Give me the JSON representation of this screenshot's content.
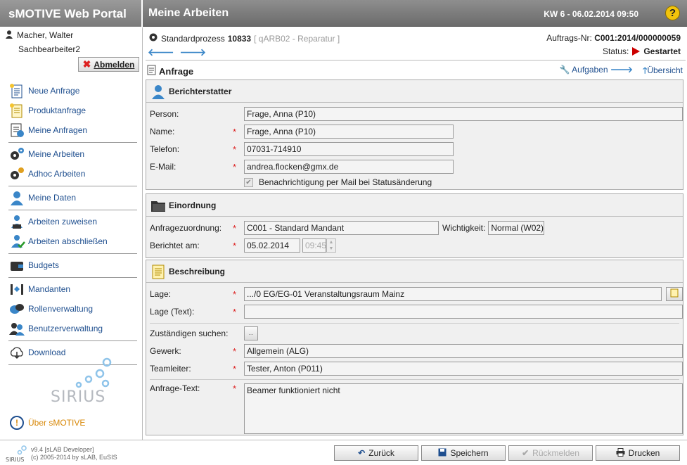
{
  "app": {
    "title": "sMOTIVE Web Portal",
    "page_title": "Meine Arbeiten",
    "week_date": "KW 6 - 06.02.2014 09:50",
    "help": "?"
  },
  "user": {
    "name": "Macher, Walter",
    "role": "Sachbearbeiter2",
    "logout": "Abmelden"
  },
  "sidebar": {
    "groups": [
      [
        {
          "label": "Neue Anfrage",
          "icon": "new-request-icon"
        },
        {
          "label": "Produktanfrage",
          "icon": "product-request-icon"
        },
        {
          "label": "Meine Anfragen",
          "icon": "my-requests-icon"
        }
      ],
      [
        {
          "label": "Meine Arbeiten",
          "icon": "gears-icon"
        },
        {
          "label": "Adhoc Arbeiten",
          "icon": "adhoc-gear-icon"
        }
      ],
      [
        {
          "label": "Meine Daten",
          "icon": "user-data-icon"
        }
      ],
      [
        {
          "label": "Arbeiten zuweisen",
          "icon": "assign-work-icon"
        },
        {
          "label": "Arbeiten abschließen",
          "icon": "complete-work-icon"
        }
      ],
      [
        {
          "label": "Budgets",
          "icon": "wallet-icon"
        }
      ],
      [
        {
          "label": "Mandanten",
          "icon": "clients-icon"
        },
        {
          "label": "Rollenverwaltung",
          "icon": "masks-icon"
        },
        {
          "label": "Benutzerverwaltung",
          "icon": "users-icon"
        }
      ],
      [
        {
          "label": "Download",
          "icon": "cloud-download-icon"
        }
      ]
    ],
    "logo_text": "SIRIUS",
    "about": "Über sMOTIVE"
  },
  "process": {
    "label": "Standardprozess",
    "number": "10833",
    "code": "[ qARB02 - Reparatur ]"
  },
  "order": {
    "label": "Auftrags-Nr:",
    "value": "C001:2014/000000059"
  },
  "status": {
    "label": "Status:",
    "value": "Gestartet"
  },
  "form": {
    "title": "Anfrage",
    "link_tasks": "Aufgaben",
    "link_overview": "Übersicht",
    "reporter": {
      "title": "Berichterstatter",
      "person_label": "Person:",
      "person": "Frage, Anna (P10)",
      "name_label": "Name:",
      "name": "Frage, Anna (P10)",
      "phone_label": "Telefon:",
      "phone": "07031-714910",
      "email_label": "E-Mail:",
      "email": "andrea.flocken@gmx.de",
      "notify_label": "Benachrichtigung per Mail bei Statusänderung",
      "notify_checked": true
    },
    "classification": {
      "title": "Einordnung",
      "assign_label": "Anfragezuordnung:",
      "assign": "C001 - Standard Mandant",
      "priority_label": "Wichtigkeit:",
      "priority": "Normal (W02)",
      "reported_label": "Berichtet am:",
      "date": "05.02.2014",
      "time": "09:45"
    },
    "description": {
      "title": "Beschreibung",
      "location_label": "Lage:",
      "location": ".../0 EG/EG-01 Veranstaltungsraum Mainz",
      "location_text_label": "Lage (Text):",
      "location_text": "",
      "responsible_label": "Zuständigen suchen:",
      "responsible_btn": "...",
      "trade_label": "Gewerk:",
      "trade": "Allgemein (ALG)",
      "team_label": "Teamleiter:",
      "team": "Tester, Anton (P011)",
      "text_label": "Anfrage-Text:",
      "text": "Beamer funktioniert nicht"
    }
  },
  "footer": {
    "version": "v9.4 [sLAB Developer]",
    "copyright": "(c) 2005-2014 by sLAB, EuSIS",
    "back": "Zurück",
    "save": "Speichern",
    "reject": "Rückmelden",
    "print": "Drucken"
  },
  "colors": {
    "link": "#1f4f8f",
    "required": "#d22222",
    "status": "#cc0000",
    "about": "#d8890a"
  }
}
